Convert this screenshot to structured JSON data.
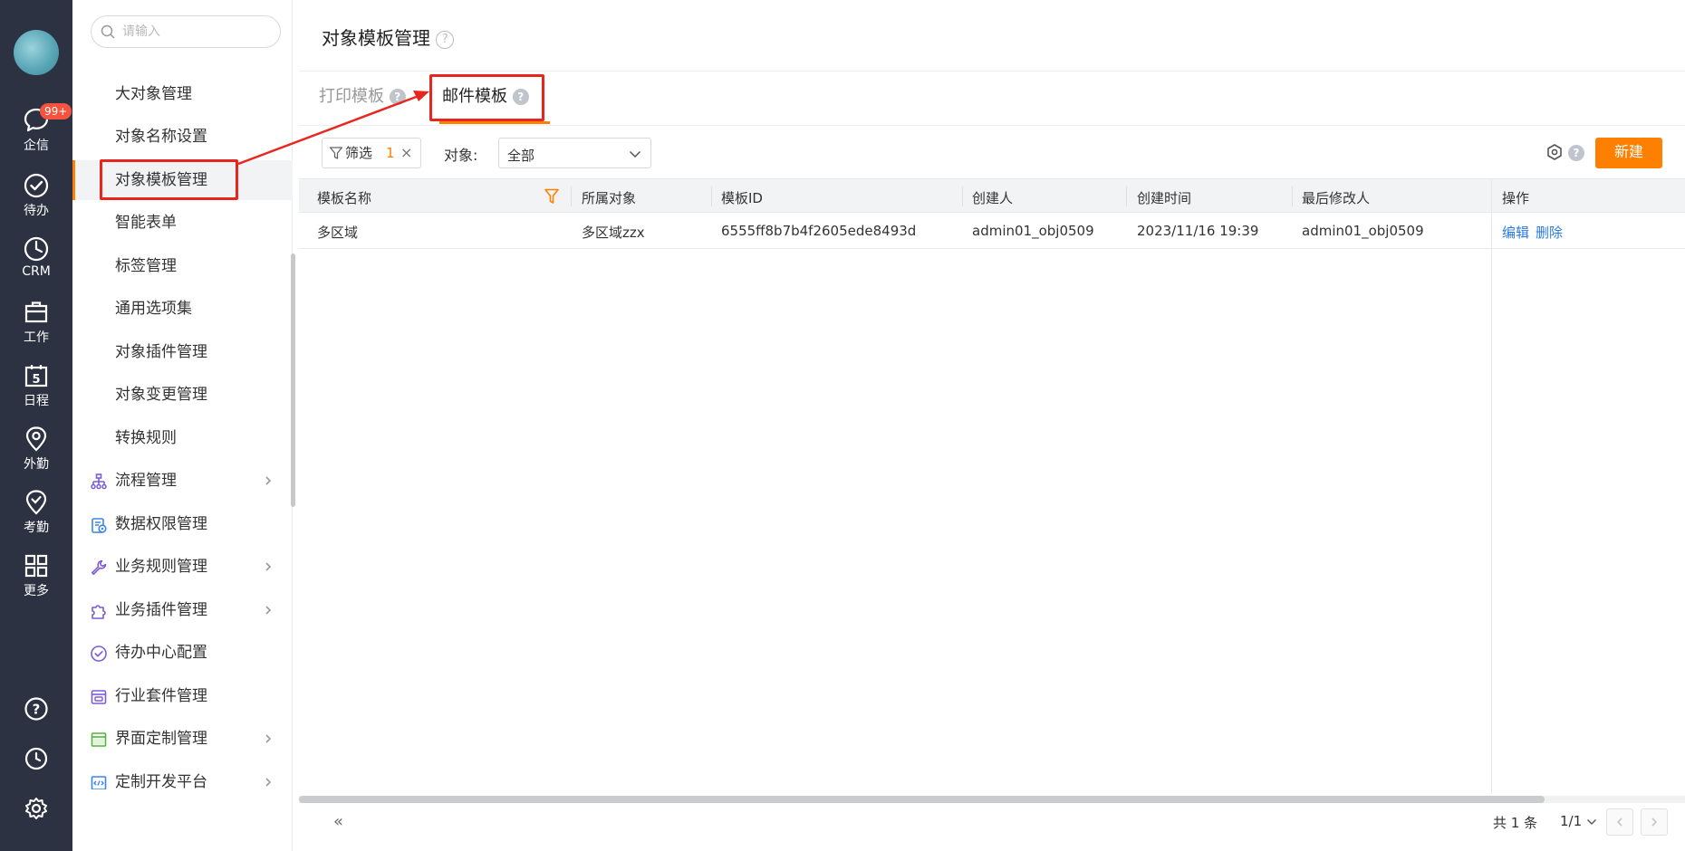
{
  "rail": {
    "badge": "99+",
    "items": [
      {
        "label": "企信",
        "icon": "chat-bubble-icon"
      },
      {
        "label": "待办",
        "icon": "check-circle-icon"
      },
      {
        "label": "CRM",
        "icon": "clock-pie-icon"
      },
      {
        "label": "工作",
        "icon": "briefcase-icon"
      },
      {
        "label": "日程",
        "icon": "calendar-icon",
        "day": "5"
      },
      {
        "label": "外勤",
        "icon": "location-pin-icon"
      },
      {
        "label": "考勤",
        "icon": "attendance-check-icon"
      },
      {
        "label": "更多",
        "icon": "grid-icon"
      }
    ],
    "bottom": [
      {
        "icon": "help-icon",
        "glyph": "?"
      },
      {
        "icon": "history-clock-icon"
      },
      {
        "icon": "settings-gear-icon"
      }
    ]
  },
  "sidebar": {
    "search_placeholder": "请输入",
    "items": [
      {
        "label": "大对象管理"
      },
      {
        "label": "对象名称设置"
      },
      {
        "label": "对象模板管理",
        "active": true
      },
      {
        "label": "智能表单"
      },
      {
        "label": "标签管理"
      },
      {
        "label": "通用选项集"
      },
      {
        "label": "对象插件管理"
      },
      {
        "label": "对象变更管理"
      },
      {
        "label": "转换规则"
      },
      {
        "label": "流程管理",
        "icon": "flow-tree-icon",
        "expandable": true
      },
      {
        "label": "数据权限管理",
        "icon": "data-permission-icon"
      },
      {
        "label": "业务规则管理",
        "icon": "wrench-icon",
        "expandable": true
      },
      {
        "label": "业务插件管理",
        "icon": "puzzle-icon",
        "expandable": true
      },
      {
        "label": "待办中心配置",
        "icon": "todo-check-icon"
      },
      {
        "label": "行业套件管理",
        "icon": "suite-icon"
      },
      {
        "label": "界面定制管理",
        "icon": "layout-icon",
        "expandable": true
      },
      {
        "label": "定制开发平台",
        "icon": "code-icon",
        "expandable": true
      }
    ],
    "collapse_glyph": "«"
  },
  "main": {
    "title": "对象模板管理",
    "help_glyph": "?",
    "tabs": [
      {
        "label": "打印模板"
      },
      {
        "label": "邮件模板",
        "active": true
      }
    ],
    "toolbar": {
      "filter_label": "筛选",
      "filter_count": "1",
      "filter_clear": "×",
      "object_label": "对象:",
      "object_value": "全部",
      "new_button": "新建"
    },
    "table": {
      "columns": [
        "模板名称",
        "所属对象",
        "模板ID",
        "创建人",
        "创建时间",
        "最后修改人",
        "操作"
      ],
      "rows": [
        {
          "name": "多区域",
          "object": "多区域zzx",
          "id": "6555ff8b7b4f2605ede8493d",
          "creator": "admin01_obj0509",
          "created_at": "2023/11/16 19:39",
          "modifier": "admin01_obj0509",
          "actions": [
            "编辑",
            "删除"
          ]
        }
      ]
    },
    "pager": {
      "total": "共 1 条",
      "page": "1/1"
    }
  },
  "colors": {
    "rail_bg": "#2c3241",
    "accent": "#ff8000",
    "link": "#2a7ae2",
    "highlight_box": "#e8261e"
  }
}
